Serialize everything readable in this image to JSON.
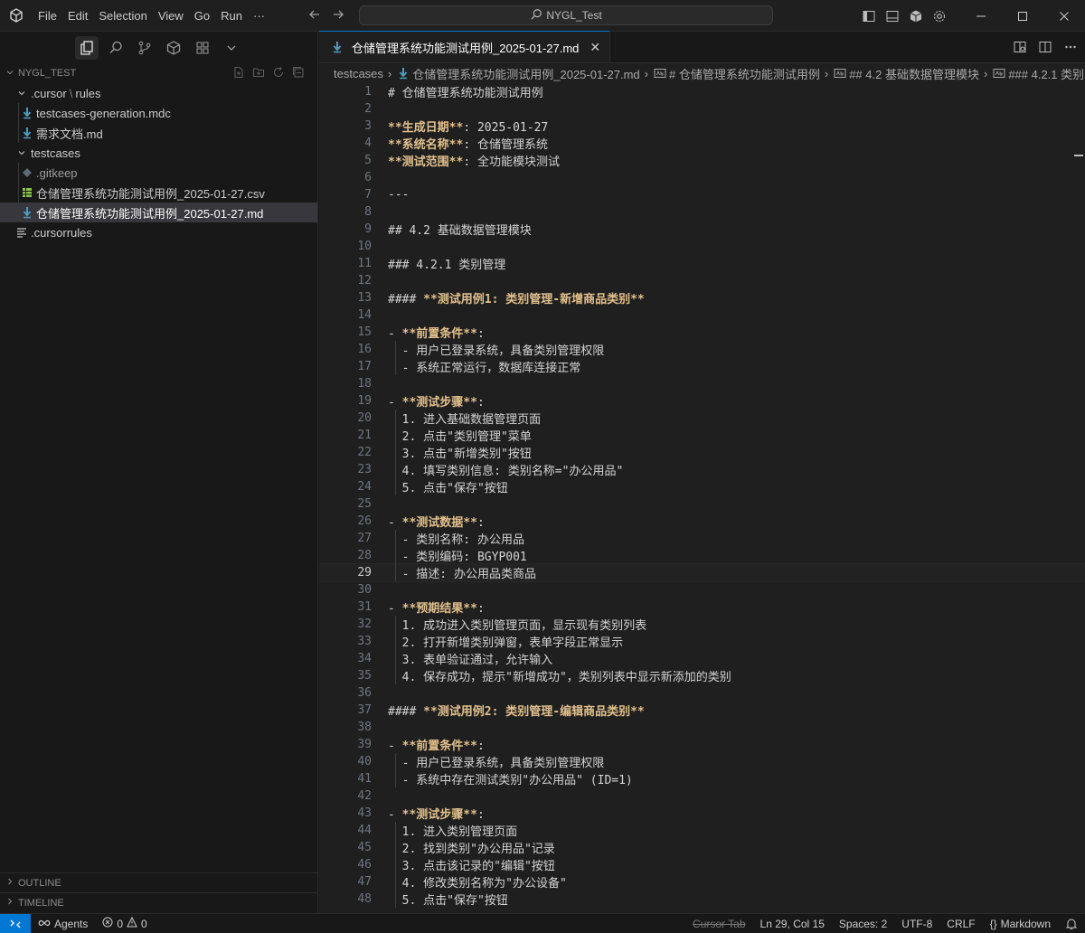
{
  "menu": [
    "File",
    "Edit",
    "Selection",
    "View",
    "Go",
    "Run",
    "···"
  ],
  "search": {
    "label": "NYGL_Test"
  },
  "explorer": {
    "workspace": "NYGL_TEST",
    "tree": [
      {
        "label": ".cursor",
        "label2": "rules",
        "sep": "\\"
      },
      {
        "label": "testcases-generation.mdc"
      },
      {
        "label": "需求文档.md"
      },
      {
        "label": "testcases"
      },
      {
        "label": ".gitkeep"
      },
      {
        "label": "仓储管理系统功能测试用例_2025-01-27.csv"
      },
      {
        "label": "仓储管理系统功能测试用例_2025-01-27.md"
      },
      {
        "label": ".cursorrules"
      }
    ],
    "outline": "OUTLINE",
    "timeline": "TIMELINE"
  },
  "editor": {
    "tab": "仓储管理系统功能测试用例_2025-01-27.md",
    "tab_close": "✕",
    "breadcrumb": [
      "testcases",
      "仓储管理系统功能测试用例_2025-01-27.md",
      "# 仓储管理系统功能测试用例",
      "## 4.2 基础数据管理模块",
      "### 4.2.1 类别"
    ],
    "current_line": 29,
    "lines": [
      {
        "n": "1",
        "t": "# 仓储管理系统功能测试用例"
      },
      {
        "n": "2",
        "t": ""
      },
      {
        "n": "3",
        "b": "**生成日期**",
        "t": ": 2025-01-27"
      },
      {
        "n": "4",
        "b": "**系统名称**",
        "t": ": 仓储管理系统"
      },
      {
        "n": "5",
        "b": "**测试范围**",
        "t": ": 全功能模块测试"
      },
      {
        "n": "6",
        "t": ""
      },
      {
        "n": "7",
        "t": "---"
      },
      {
        "n": "8",
        "t": ""
      },
      {
        "n": "9",
        "t": "## 4.2 基础数据管理模块"
      },
      {
        "n": "10",
        "t": ""
      },
      {
        "n": "11",
        "t": "### 4.2.1 类别管理"
      },
      {
        "n": "12",
        "t": ""
      },
      {
        "n": "13",
        "p": "#### ",
        "b": "**测试用例1: 类别管理-新增商品类别**",
        "t": ""
      },
      {
        "n": "14",
        "t": ""
      },
      {
        "n": "15",
        "p": "- ",
        "b": "**前置条件**",
        "t": ":"
      },
      {
        "n": "16",
        "t": "  - 用户已登录系统，具备类别管理权限"
      },
      {
        "n": "17",
        "t": "  - 系统正常运行，数据库连接正常"
      },
      {
        "n": "18",
        "t": ""
      },
      {
        "n": "19",
        "p": "- ",
        "b": "**测试步骤**",
        "t": ":"
      },
      {
        "n": "20",
        "t": "  1. 进入基础数据管理页面"
      },
      {
        "n": "21",
        "t": "  2. 点击\"类别管理\"菜单"
      },
      {
        "n": "22",
        "t": "  3. 点击\"新增类别\"按钮"
      },
      {
        "n": "23",
        "t": "  4. 填写类别信息: 类别名称=\"办公用品\""
      },
      {
        "n": "24",
        "t": "  5. 点击\"保存\"按钮"
      },
      {
        "n": "25",
        "t": ""
      },
      {
        "n": "26",
        "p": "- ",
        "b": "**测试数据**",
        "t": ":"
      },
      {
        "n": "27",
        "t": "  - 类别名称: 办公用品"
      },
      {
        "n": "28",
        "t": "  - 类别编码: BGYP001"
      },
      {
        "n": "29",
        "t": "  - 描述: 办公用品类商品"
      },
      {
        "n": "30",
        "t": ""
      },
      {
        "n": "31",
        "p": "- ",
        "b": "**预期结果**",
        "t": ":"
      },
      {
        "n": "32",
        "t": "  1. 成功进入类别管理页面，显示现有类别列表"
      },
      {
        "n": "33",
        "t": "  2. 打开新增类别弹窗，表单字段正常显示"
      },
      {
        "n": "34",
        "t": "  3. 表单验证通过，允许输入"
      },
      {
        "n": "35",
        "t": "  4. 保存成功，提示\"新增成功\"，类别列表中显示新添加的类别"
      },
      {
        "n": "36",
        "t": ""
      },
      {
        "n": "37",
        "p": "#### ",
        "b": "**测试用例2: 类别管理-编辑商品类别**",
        "t": ""
      },
      {
        "n": "38",
        "t": ""
      },
      {
        "n": "39",
        "p": "- ",
        "b": "**前置条件**",
        "t": ":"
      },
      {
        "n": "40",
        "t": "  - 用户已登录系统，具备类别管理权限"
      },
      {
        "n": "41",
        "t": "  - 系统中存在测试类别\"办公用品\" (ID=1)"
      },
      {
        "n": "42",
        "t": ""
      },
      {
        "n": "43",
        "p": "- ",
        "b": "**测试步骤**",
        "t": ":"
      },
      {
        "n": "44",
        "t": "  1. 进入类别管理页面"
      },
      {
        "n": "45",
        "t": "  2. 找到类别\"办公用品\"记录"
      },
      {
        "n": "46",
        "t": "  3. 点击该记录的\"编辑\"按钮"
      },
      {
        "n": "47",
        "t": "  4. 修改类别名称为\"办公设备\""
      },
      {
        "n": "48",
        "t": "  5. 点击\"保存\"按钮"
      }
    ]
  },
  "status": {
    "agents": "Agents",
    "errors": "0",
    "warnings": "0",
    "cursor_tab": "Cursor Tab",
    "position": "Ln 29, Col 15",
    "spaces": "Spaces: 2",
    "encoding": "UTF-8",
    "eol": "CRLF",
    "language": "Markdown"
  },
  "colors": {
    "accent": "#0078d4",
    "heading_bold": "#e2c08d",
    "md_icon": "#519aba",
    "csv_icon": "#8bc34a"
  }
}
